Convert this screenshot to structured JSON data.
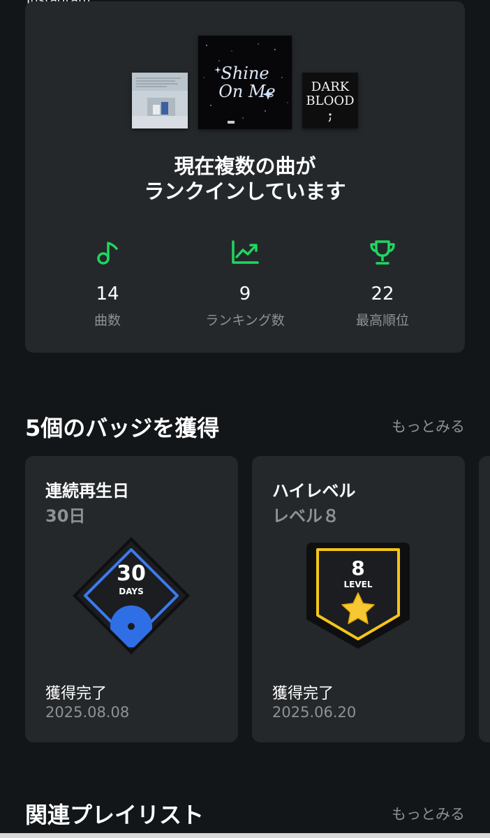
{
  "top": {
    "cut_text": "Instagram"
  },
  "ranking": {
    "covers": [
      {
        "name": "cover-album-1",
        "lines": ""
      },
      {
        "name": "cover-shine-on-me",
        "title_line1": "Shine",
        "title_line2": "On Me"
      },
      {
        "name": "cover-dark-blood",
        "title_line1": "DARK",
        "title_line2": "BLOOD"
      }
    ],
    "headline_line1": "現在複数の曲が",
    "headline_line2": "ランクインしています",
    "stats": [
      {
        "icon": "music-note-icon",
        "value": "14",
        "label": "曲数"
      },
      {
        "icon": "trending-chart-icon",
        "value": "9",
        "label": "ランキング数"
      },
      {
        "icon": "trophy-icon",
        "value": "22",
        "label": "最高順位"
      }
    ],
    "accent_color": "#1ed760"
  },
  "badges": {
    "section_title": "5個のバッジを獲得",
    "more_label": "もっとみる",
    "items": [
      {
        "title": "連続再生日",
        "subtitle": "30日",
        "art_number": "30",
        "art_caption": "DAYS",
        "status": "獲得完了",
        "date": "2025.08.08",
        "accent_color": "#3a7bf0"
      },
      {
        "title": "ハイレベル",
        "subtitle": "レベル８",
        "art_number": "8",
        "art_caption": "LEVEL",
        "status": "獲得完了",
        "date": "2025.06.20",
        "accent_color": "#f5c518"
      }
    ]
  },
  "playlists": {
    "section_title": "関連プレイリスト",
    "more_label": "もっとみる"
  }
}
